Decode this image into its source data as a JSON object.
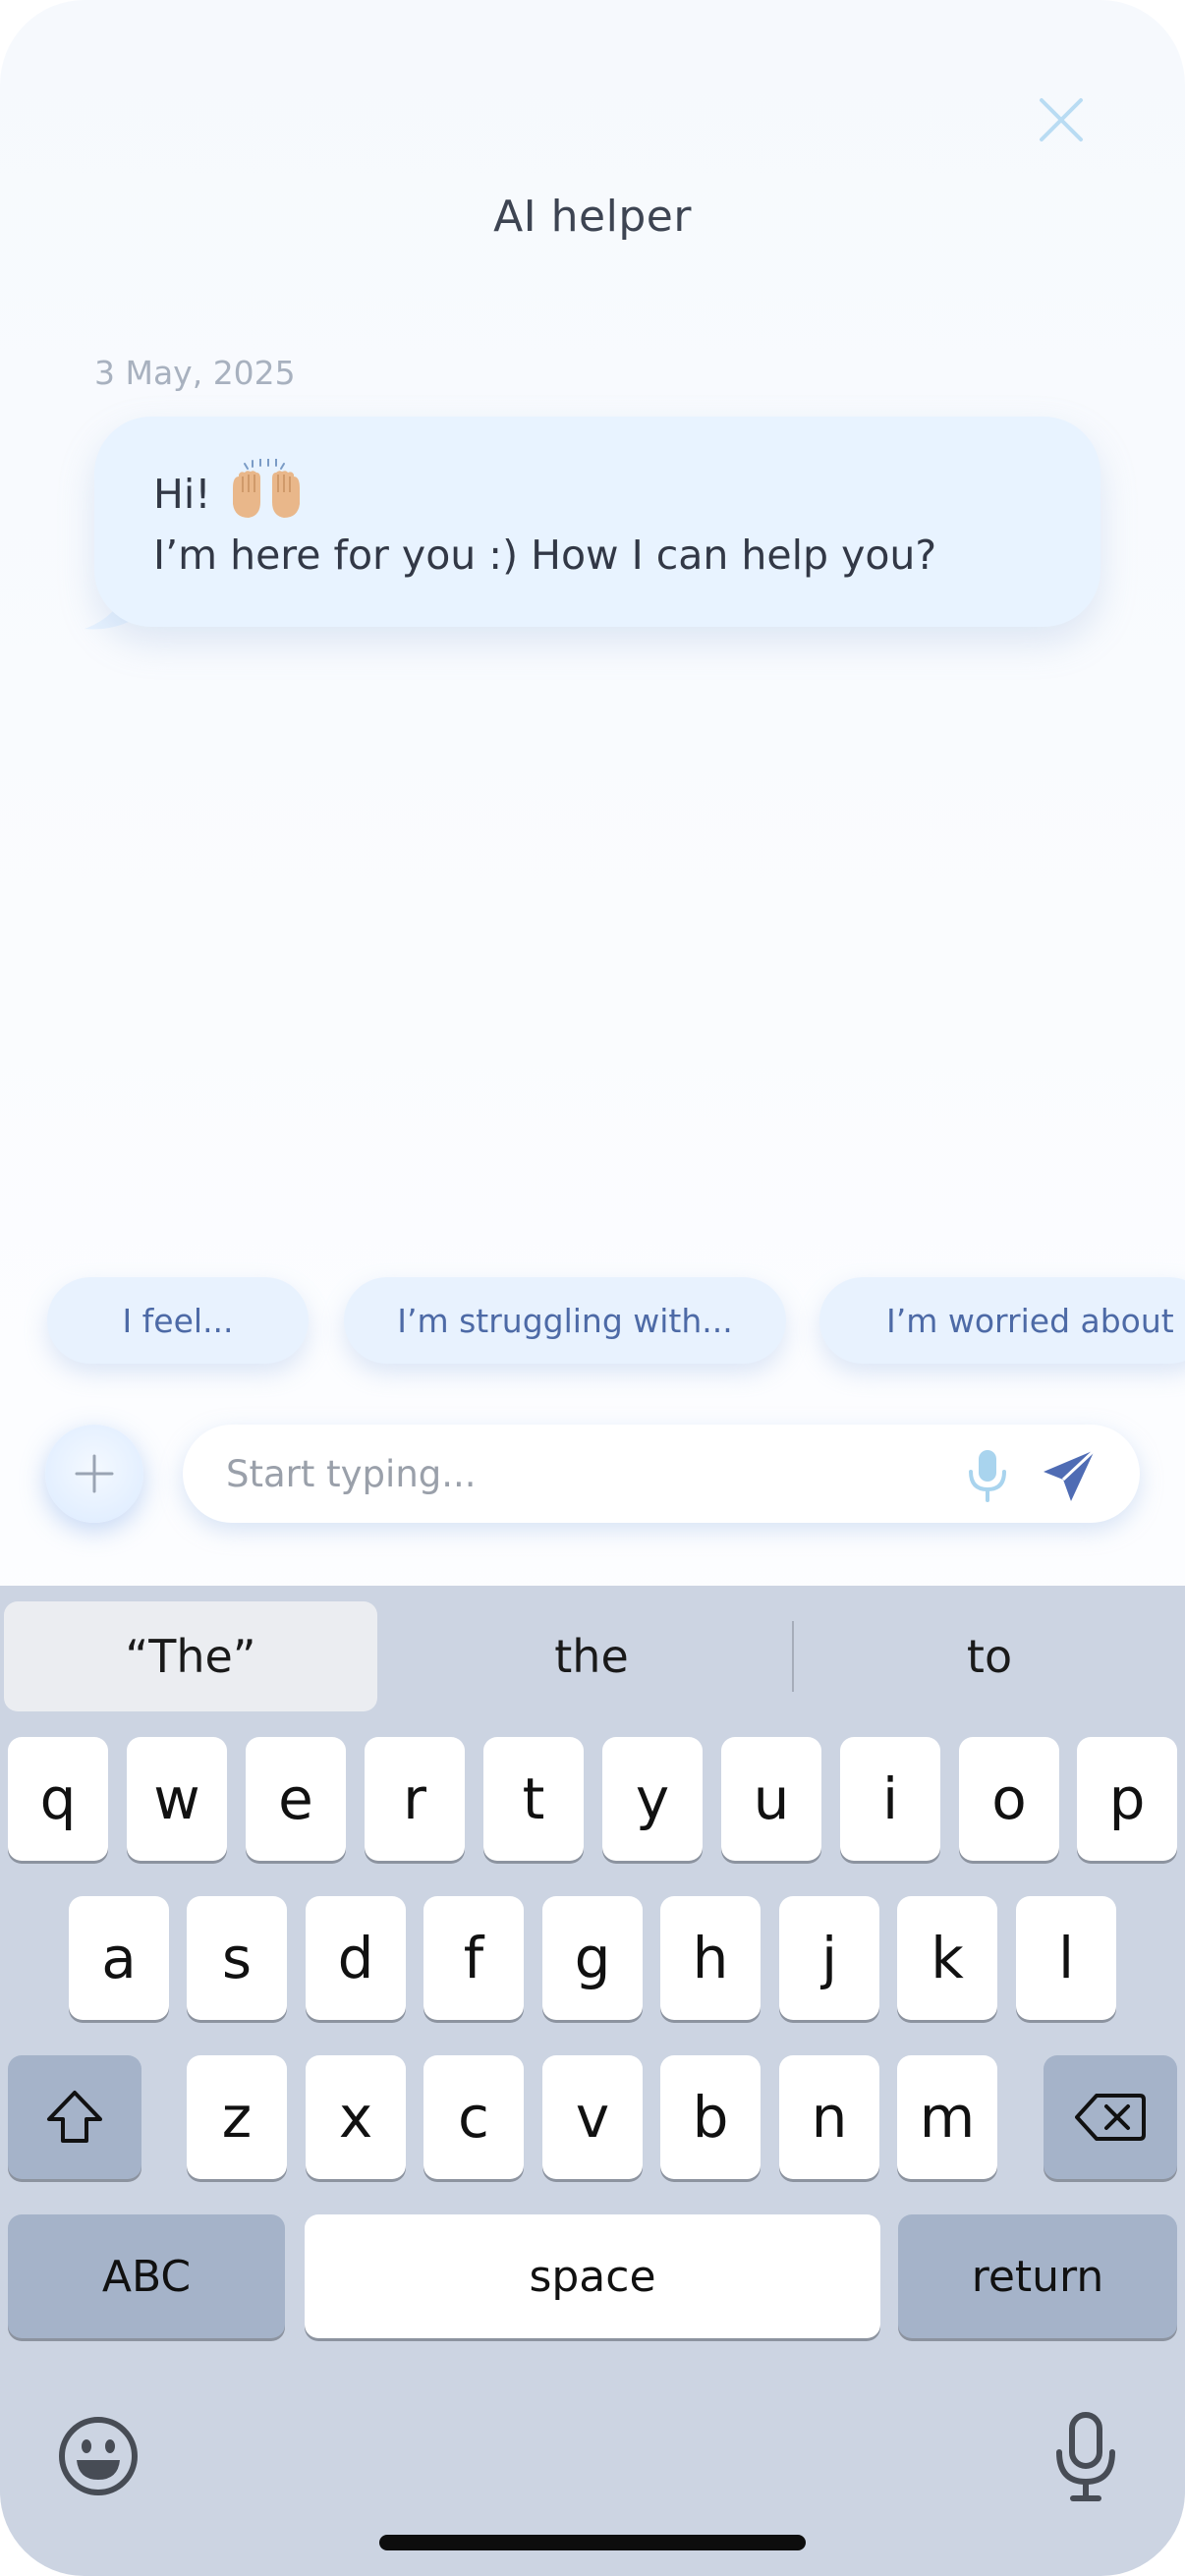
{
  "header": {
    "title": "AI helper"
  },
  "chat": {
    "date": "3 May, 2025",
    "messages": [
      {
        "line1": "Hi!",
        "line2": "I’m here for you :) How I can help you?"
      }
    ]
  },
  "suggestions": [
    "I feel...",
    "I’m struggling with...",
    "I’m worried about"
  ],
  "composer": {
    "placeholder": "Start typing..."
  },
  "keyboard": {
    "predictions": [
      "“The”",
      "the",
      "to"
    ],
    "row1": [
      "q",
      "w",
      "e",
      "r",
      "t",
      "y",
      "u",
      "i",
      "o",
      "p"
    ],
    "row2": [
      "a",
      "s",
      "d",
      "f",
      "g",
      "h",
      "j",
      "k",
      "l"
    ],
    "row3": [
      "z",
      "x",
      "c",
      "v",
      "b",
      "n",
      "m"
    ],
    "abc_label": "ABC",
    "space_label": "space",
    "return_label": "return"
  },
  "icons": {
    "close": "close-icon",
    "plus": "plus-icon",
    "mic": "microphone-icon",
    "send": "send-icon",
    "emoji": "raising-hands-emoji",
    "shift": "shift-icon",
    "delete": "delete-icon",
    "emoji_keyboard": "emoji-icon",
    "dictation": "microphone-icon"
  },
  "colors": {
    "accent": "#4d6aa6",
    "bubble": "#e8f3ff",
    "close_icon": "#b9dcf3",
    "send_icon": "#4f6cb4",
    "mic_icon": "#a9d4ee",
    "keyboard_bg": "#ccd4e2",
    "function_key": "#a5b3c9"
  }
}
